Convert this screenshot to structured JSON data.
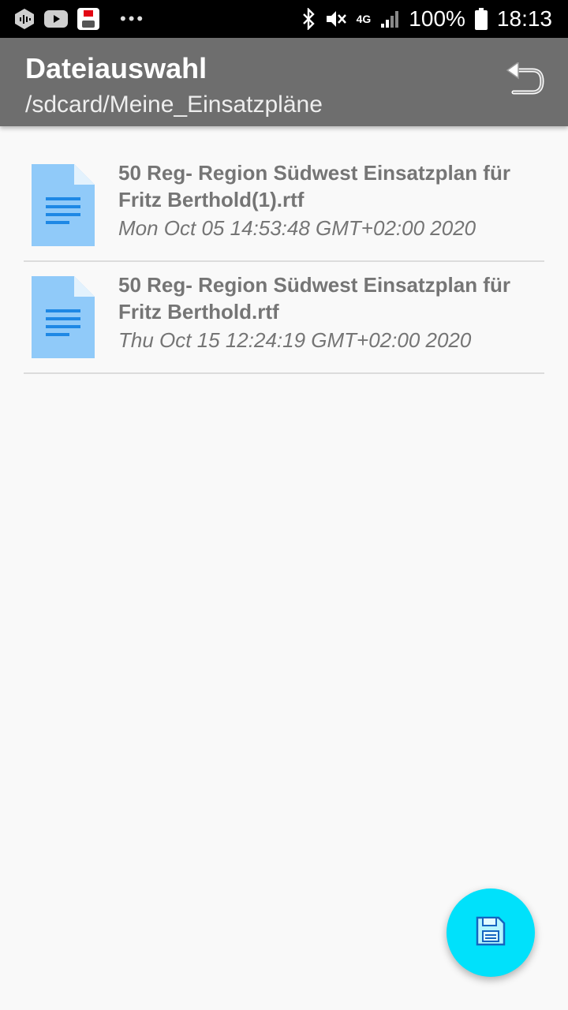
{
  "status_bar": {
    "network": "4G",
    "battery": "100%",
    "time": "18:13",
    "dots": "•••",
    "left_icons": [
      "app-hex-icon",
      "youtube-icon",
      "db-app-icon"
    ],
    "right_icons": [
      "bluetooth-icon",
      "mute-icon",
      "signal-icon",
      "battery-icon"
    ]
  },
  "appbar": {
    "title": "Dateiauswahl",
    "subtitle": "/sdcard/Meine_Einsatzpläne",
    "back_icon": "undo-arrow-icon"
  },
  "files": [
    {
      "name": "50 Reg- Region Südwest Einsatzplan für Fritz Berthold(1).rtf",
      "date": "Mon Oct 05 14:53:48 GMT+02:00 2020",
      "icon": "document-icon"
    },
    {
      "name": "50 Reg- Region Südwest Einsatzplan für Fritz Berthold.rtf",
      "date": "Thu Oct 15 12:24:19 GMT+02:00 2020",
      "icon": "document-icon"
    }
  ],
  "fab": {
    "icon": "save-floppy-icon"
  },
  "colors": {
    "appbar": "#6e6e6e",
    "fab": "#00e1fb",
    "file_icon": "#90caf9",
    "file_icon_lines": "#1e88e5",
    "text": "#757575"
  }
}
